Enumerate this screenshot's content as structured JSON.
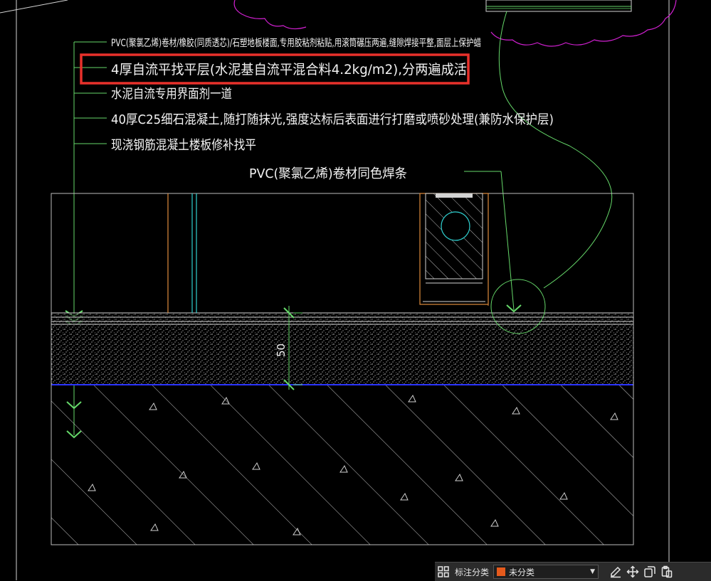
{
  "drawing": {
    "colors": {
      "background": "#000000",
      "text": "#f2f2f2",
      "leader": "#66d96a",
      "dim": "#4dd24d",
      "frame": "#d3d3d3",
      "highlight": "#e8312b",
      "cyan": "#2fd0d0",
      "orange": "#e08b3c",
      "blue": "#2b34ff",
      "magenta": "#d020d0",
      "hatch": "#cfcfcf"
    },
    "callouts": [
      "PVC(聚氯乙烯)卷材/橡胶(同质透芯)/石塑地板楼面,专用胶粘剂粘贴,用滚筒碾压两遍,缝隙焊接平整,面层上保护蜡",
      "4厚自流平找平层(水泥基自流平混合料4.2kg/m2),分两遍成活",
      "水泥自流专用界面剂一道",
      "40厚C25细石混凝土,随打随抹光,强度达标后表面进行打磨或喷砂处理(兼防水保护层)",
      "现浇钢筋混凝土楼板修补找平"
    ],
    "weld_note": "PVC(聚氯乙烯)卷材同色焊条",
    "dimension_value": "50"
  },
  "annotation_toolbar": {
    "category_label": "标注分类",
    "category_value": "未分类",
    "category_color": "#e55a1c",
    "icons": [
      "grid-icon",
      "edit-icon",
      "move-icon",
      "copy-icon",
      "paste-icon"
    ]
  }
}
